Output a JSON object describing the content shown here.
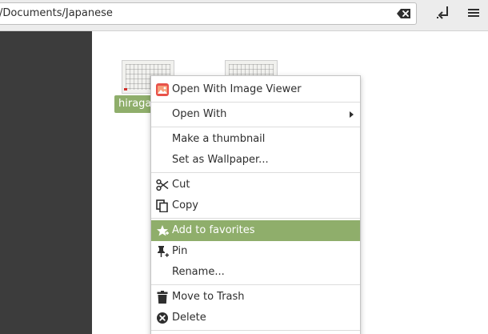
{
  "location": {
    "path": "/Documents/Japanese"
  },
  "toolbar": {
    "clear_icon": "clear-text-icon",
    "toggle_icon": "toggle-location-icon"
  },
  "files": [
    {
      "name": "hiragana"
    }
  ],
  "context_menu": {
    "items": [
      {
        "label": "Open With Image Viewer",
        "icon": "image-viewer-icon"
      },
      {
        "label": "Open With",
        "icon": "",
        "submenu": true
      },
      {
        "label": "Make a thumbnail",
        "icon": ""
      },
      {
        "label": "Set as Wallpaper...",
        "icon": ""
      },
      {
        "label": "Cut",
        "icon": "scissors-icon"
      },
      {
        "label": "Copy",
        "icon": "copy-icon"
      },
      {
        "label": "Add to favorites",
        "icon": "star-add-icon",
        "highlighted": true
      },
      {
        "label": "Pin",
        "icon": "pin-icon"
      },
      {
        "label": "Rename...",
        "icon": ""
      },
      {
        "label": "Move to Trash",
        "icon": "trash-icon"
      },
      {
        "label": "Delete",
        "icon": "delete-icon"
      }
    ]
  },
  "colors": {
    "accent": "#8fae6b",
    "sidebar": "#3c3c3c",
    "toolbar": "#ececec"
  }
}
